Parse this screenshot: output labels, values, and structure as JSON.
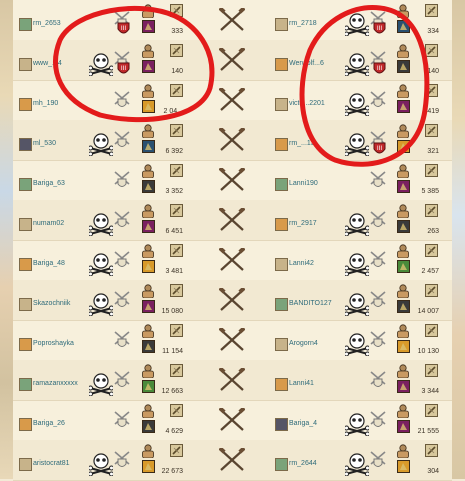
{
  "rows": [
    {
      "left": {
        "name": "rm_2653",
        "value": "333"
      },
      "right": {
        "name": "rm_2718",
        "value": "334"
      }
    },
    {
      "left": {
        "name": "www_...4",
        "value": "140"
      },
      "right": {
        "name": "Werwolf...6",
        "value": "140"
      }
    },
    {
      "left": {
        "name": "mh_190",
        "value": "2 04..."
      },
      "right": {
        "name": "victo...2201",
        "value": "419"
      }
    },
    {
      "left": {
        "name": "ml_530",
        "value": "6 392"
      },
      "right": {
        "name": "rm_...13",
        "value": "321"
      }
    },
    {
      "left": {
        "name": "Bariga_63",
        "value": "3 352"
      },
      "right": {
        "name": "Lanni190",
        "value": "5 385"
      }
    },
    {
      "left": {
        "name": "numam02",
        "value": "6 451"
      },
      "right": {
        "name": "rm_2917",
        "value": "263"
      }
    },
    {
      "left": {
        "name": "Bariga_48",
        "value": "3 481"
      },
      "right": {
        "name": "Lanni42",
        "value": "2 457"
      }
    },
    {
      "left": {
        "name": "Skazochniik",
        "value": "15 080"
      },
      "right": {
        "name": "BANDITO127",
        "value": "14 007"
      }
    },
    {
      "left": {
        "name": "Poproshayka",
        "value": "11 154"
      },
      "right": {
        "name": "Arogorn4",
        "value": "10 130"
      }
    },
    {
      "left": {
        "name": "ramazanxxxxx",
        "value": "12 663"
      },
      "right": {
        "name": "Lanni41",
        "value": "3 344"
      }
    },
    {
      "left": {
        "name": "Bariga_26",
        "value": "4 629"
      },
      "right": {
        "name": "Bariga_4",
        "value": "21 555"
      }
    },
    {
      "left": {
        "name": "aristocrat81",
        "value": "22 673"
      },
      "right": {
        "name": "rm_2644",
        "value": "304"
      }
    }
  ]
}
